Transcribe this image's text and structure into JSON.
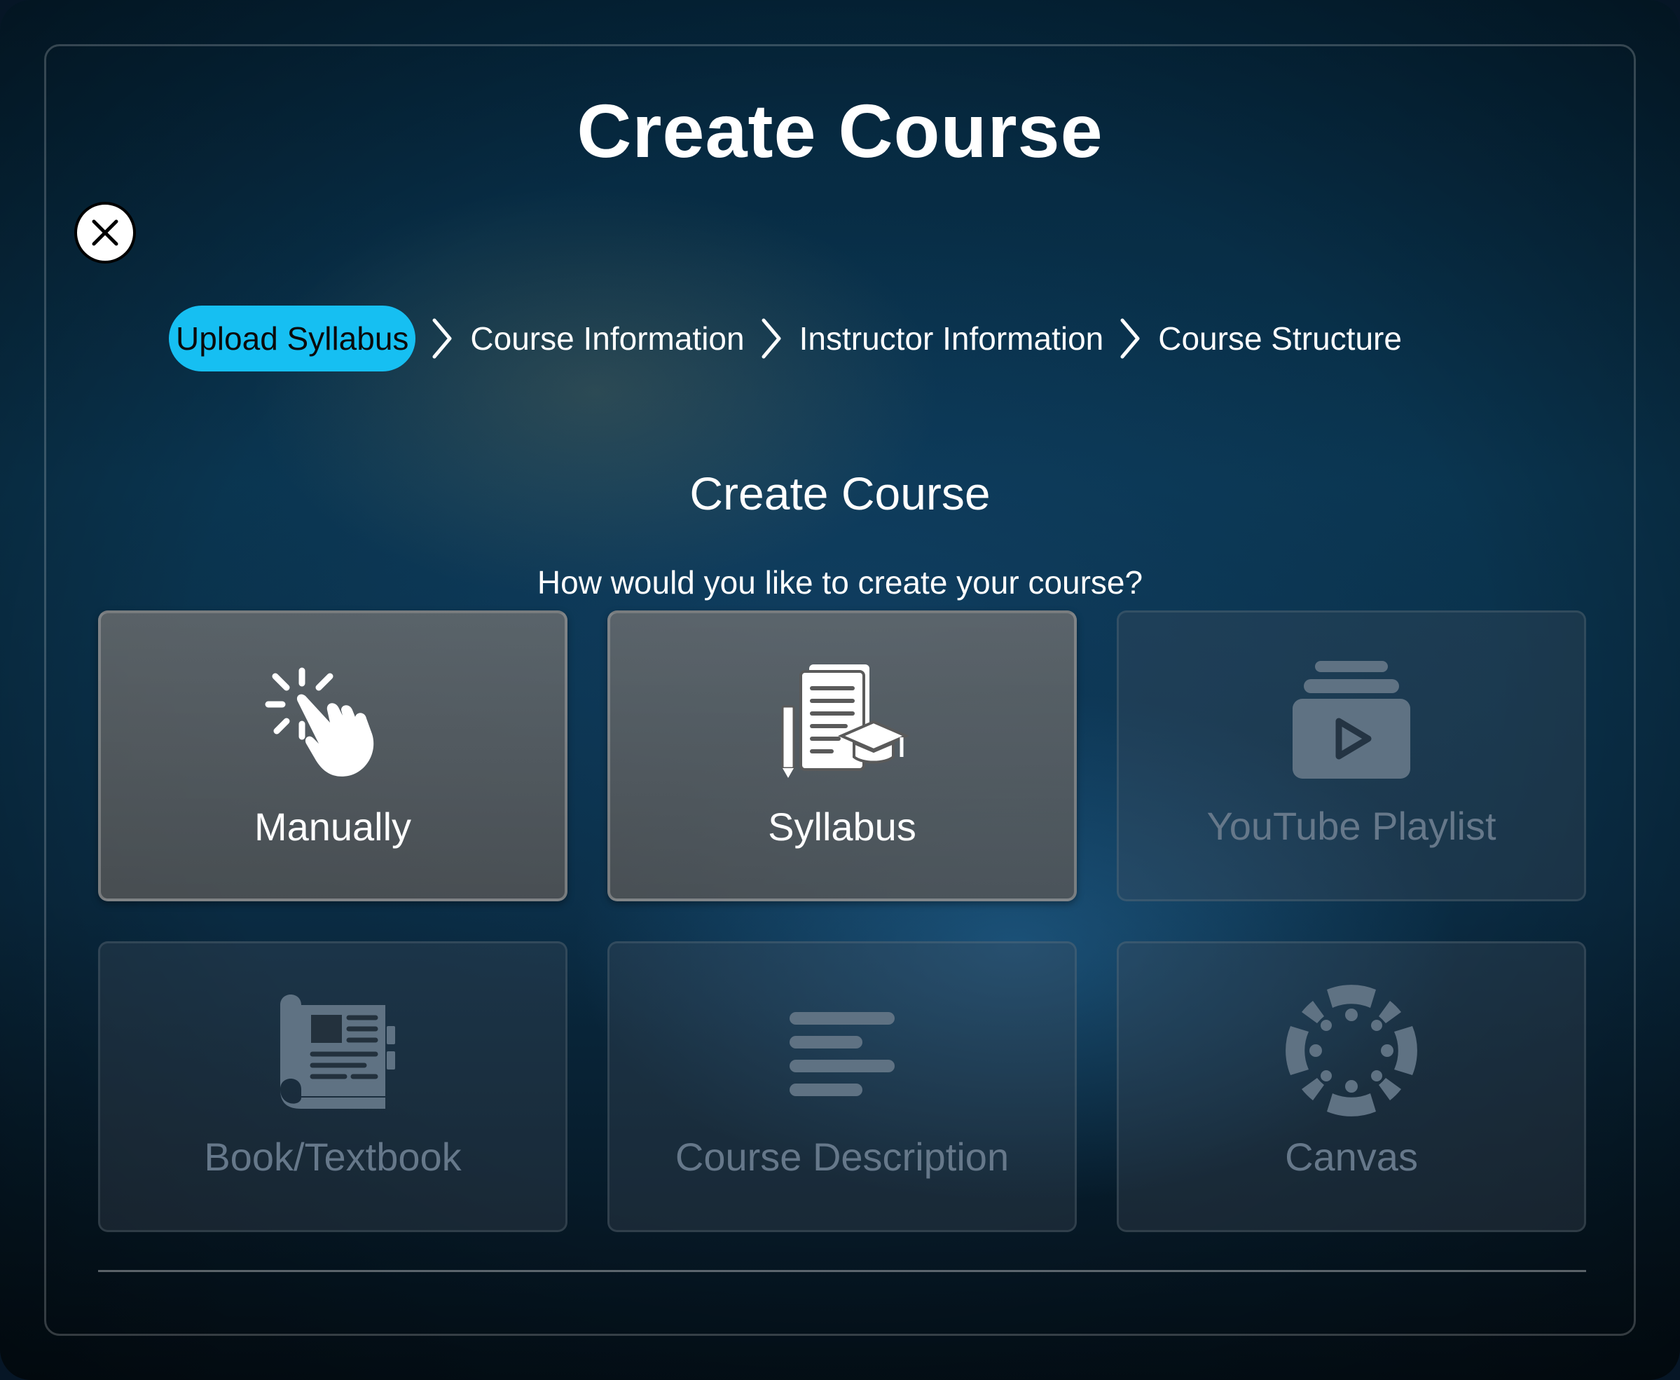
{
  "modal": {
    "title": "Create Course",
    "close_icon": "close-icon"
  },
  "stepper": {
    "steps": [
      {
        "label": "Upload Syllabus",
        "active": true
      },
      {
        "label": "Course Information",
        "active": false
      },
      {
        "label": "Instructor Information",
        "active": false
      },
      {
        "label": "Course Structure",
        "active": false
      }
    ],
    "separator_icon": "chevron-right-icon"
  },
  "content": {
    "section_title": "Create Course",
    "prompt": "How would you like to create your course?"
  },
  "options": [
    {
      "label": "Manually",
      "icon": "hand-pointer-icon",
      "enabled": true
    },
    {
      "label": "Syllabus",
      "icon": "syllabus-icon",
      "enabled": true
    },
    {
      "label": "YouTube Playlist",
      "icon": "video-playlist-icon",
      "enabled": false
    },
    {
      "label": "Book/Textbook",
      "icon": "book-icon",
      "enabled": false
    },
    {
      "label": "Course Description",
      "icon": "text-lines-icon",
      "enabled": false
    },
    {
      "label": "Canvas",
      "icon": "canvas-logo-icon",
      "enabled": false
    }
  ],
  "colors": {
    "active_step": "#16bff2",
    "enabled_icon": "#ffffff",
    "disabled_icon": "#5f7283"
  }
}
